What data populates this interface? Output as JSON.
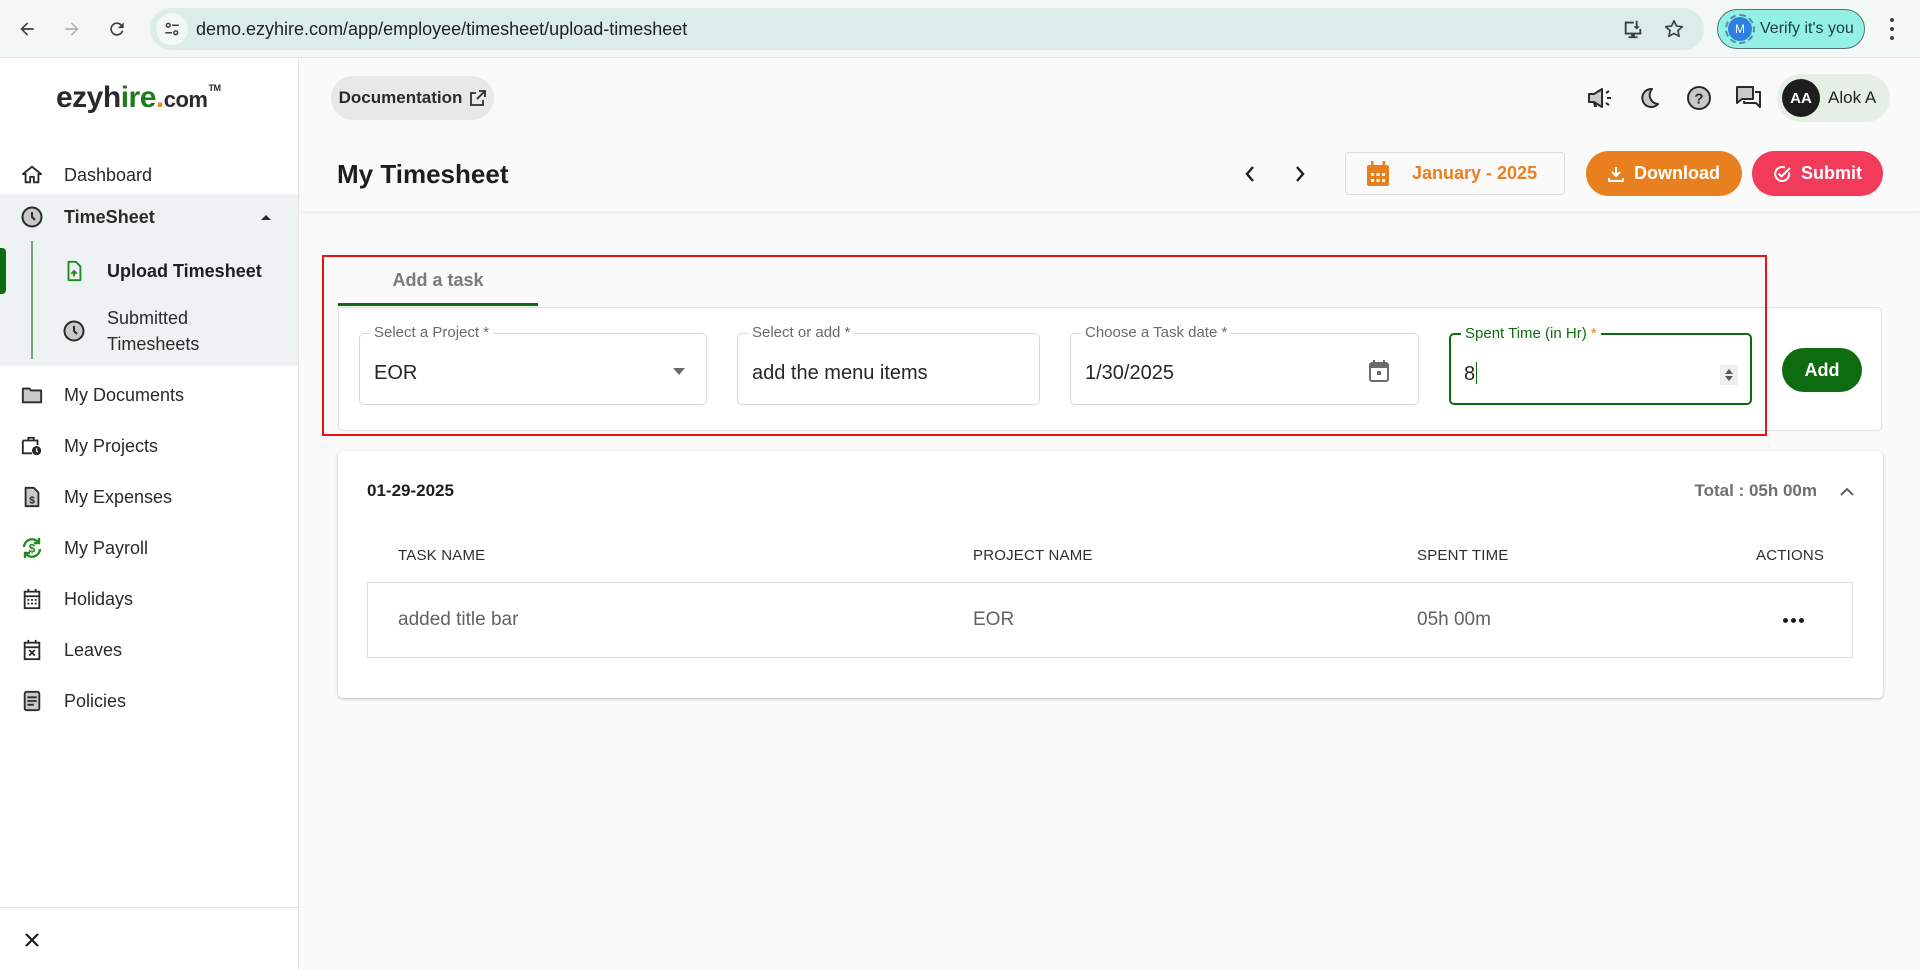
{
  "browser": {
    "url": "demo.ezyhire.com/app/employee/timesheet/upload-timesheet",
    "verify_label": "Verify it's you",
    "verify_avatar": "M"
  },
  "sidebar": {
    "logo": {
      "part1": "ezyh",
      "part2": "ire",
      "dot": ".",
      "com": "com",
      "tm": "TM"
    },
    "items": [
      {
        "label": "Dashboard",
        "icon": "home-icon"
      },
      {
        "label": "TimeSheet",
        "icon": "clock-icon",
        "expanded": true,
        "children": [
          {
            "label": "Upload Timesheet",
            "icon": "file-upload-icon",
            "active": true
          },
          {
            "label": "Submitted Timesheets",
            "icon": "clock-icon"
          }
        ]
      },
      {
        "label": "My Documents",
        "icon": "folder-icon"
      },
      {
        "label": "My Projects",
        "icon": "briefcase-clock-icon"
      },
      {
        "label": "My Expenses",
        "icon": "dollar-file-icon"
      },
      {
        "label": "My Payroll",
        "icon": "payroll-sync-icon"
      },
      {
        "label": "Holidays",
        "icon": "calendar-icon"
      },
      {
        "label": "Leaves",
        "icon": "calendar-x-icon"
      },
      {
        "label": "Policies",
        "icon": "document-icon"
      }
    ],
    "sub_label_line1": "Submitted",
    "sub_label_line2": "Timesheets"
  },
  "header": {
    "documentation_label": "Documentation",
    "user": {
      "initials": "AA",
      "name": "Alok A"
    },
    "page_title": "My Timesheet",
    "period_label": "January - 2025",
    "download_label": "Download",
    "submit_label": "Submit"
  },
  "form": {
    "tab_label": "Add a task",
    "project": {
      "label": "Select a Project *",
      "value": "EOR"
    },
    "task": {
      "label": "Select or add *",
      "value": "add the menu items"
    },
    "date": {
      "label": "Choose a Task date *",
      "value": "1/30/2025"
    },
    "spent": {
      "label": "Spent Time (in Hr)",
      "required_mark": "*",
      "value": "8"
    },
    "add_label": "Add"
  },
  "entries": [
    {
      "date": "01-29-2025",
      "total": "Total : 05h 00m",
      "columns": [
        "TASK NAME",
        "PROJECT NAME",
        "SPENT TIME",
        "ACTIONS"
      ],
      "rows": [
        {
          "task": "added title bar",
          "project": "EOR",
          "spent": "05h 00m"
        }
      ]
    }
  ],
  "colors": {
    "brand_green": "#0f6b0f",
    "accent_orange": "#e8801f",
    "submit_red": "#f23a5a",
    "highlight_red": "#ee1111"
  }
}
